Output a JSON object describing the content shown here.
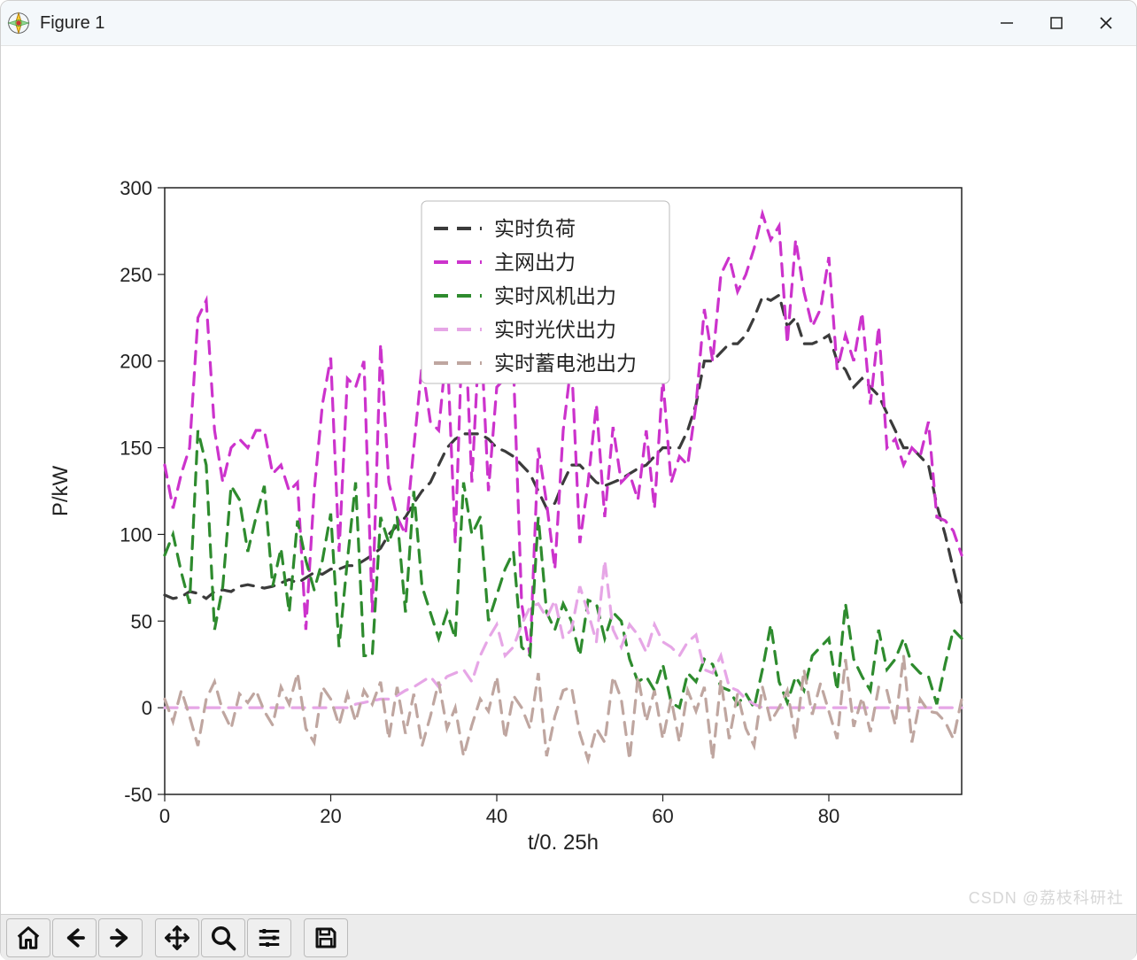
{
  "window": {
    "title": "Figure 1"
  },
  "watermark": "CSDN @荔枝科研社",
  "toolbar": {
    "home": "Home",
    "back": "Back",
    "forward": "Forward",
    "pan": "Pan",
    "zoom": "Zoom",
    "configure": "Configure",
    "save": "Save"
  },
  "chart_data": {
    "type": "line",
    "xlabel": "t/0. 25h",
    "ylabel": "P/kW",
    "xlim": [
      0,
      96
    ],
    "ylim": [
      -50,
      300
    ],
    "x_ticks": [
      0,
      20,
      40,
      60,
      80
    ],
    "y_ticks": [
      -50,
      0,
      50,
      100,
      150,
      200,
      250,
      300
    ],
    "legend_position": "upper-center",
    "line_style": "dashed",
    "x": [
      0,
      1,
      2,
      3,
      4,
      5,
      6,
      7,
      8,
      9,
      10,
      11,
      12,
      13,
      14,
      15,
      16,
      17,
      18,
      19,
      20,
      21,
      22,
      23,
      24,
      25,
      26,
      27,
      28,
      29,
      30,
      31,
      32,
      33,
      34,
      35,
      36,
      37,
      38,
      39,
      40,
      41,
      42,
      43,
      44,
      45,
      46,
      47,
      48,
      49,
      50,
      51,
      52,
      53,
      54,
      55,
      56,
      57,
      58,
      59,
      60,
      61,
      62,
      63,
      64,
      65,
      66,
      67,
      68,
      69,
      70,
      71,
      72,
      73,
      74,
      75,
      76,
      77,
      78,
      79,
      80,
      81,
      82,
      83,
      84,
      85,
      86,
      87,
      88,
      89,
      90,
      91,
      92,
      93,
      94,
      95,
      96
    ],
    "series": [
      {
        "name": "实时负荷",
        "color": "#3b3b3b",
        "values": [
          65,
          63,
          64,
          67,
          66,
          63,
          67,
          68,
          67,
          70,
          71,
          70,
          69,
          70,
          72,
          74,
          72,
          75,
          78,
          77,
          80,
          80,
          82,
          82,
          85,
          88,
          92,
          100,
          105,
          110,
          118,
          125,
          130,
          140,
          150,
          155,
          158,
          158,
          158,
          155,
          150,
          148,
          145,
          140,
          135,
          125,
          115,
          118,
          130,
          140,
          140,
          135,
          130,
          128,
          130,
          132,
          135,
          138,
          140,
          145,
          150,
          150,
          150,
          160,
          175,
          200,
          200,
          205,
          210,
          210,
          215,
          225,
          237,
          235,
          238,
          220,
          225,
          210,
          210,
          212,
          215,
          200,
          195,
          185,
          190,
          185,
          180,
          170,
          160,
          150,
          150,
          145,
          140,
          117,
          100,
          80,
          60
        ]
      },
      {
        "name": "主网出力",
        "color": "#cc33cc",
        "values": [
          140,
          115,
          135,
          150,
          225,
          235,
          160,
          130,
          150,
          155,
          150,
          160,
          160,
          135,
          140,
          125,
          130,
          45,
          125,
          175,
          202,
          90,
          190,
          185,
          200,
          55,
          210,
          130,
          110,
          100,
          150,
          198,
          165,
          160,
          210,
          95,
          240,
          130,
          225,
          125,
          185,
          190,
          198,
          60,
          30,
          150,
          118,
          80,
          160,
          200,
          95,
          130,
          175,
          110,
          162,
          130,
          135,
          120,
          160,
          115,
          190,
          130,
          145,
          140,
          175,
          230,
          200,
          250,
          260,
          240,
          250,
          265,
          285,
          270,
          278,
          210,
          270,
          240,
          220,
          230,
          260,
          195,
          215,
          200,
          228,
          175,
          220,
          150,
          155,
          140,
          150,
          145,
          165,
          110,
          108,
          102,
          88
        ]
      },
      {
        "name": "实时风机出力",
        "color": "#2e8b2e",
        "values": [
          88,
          100,
          78,
          60,
          160,
          140,
          45,
          70,
          128,
          120,
          90,
          110,
          128,
          70,
          92,
          55,
          108,
          85,
          68,
          85,
          112,
          35,
          85,
          130,
          30,
          30,
          110,
          95,
          110,
          55,
          125,
          70,
          55,
          40,
          55,
          40,
          130,
          100,
          110,
          50,
          65,
          80,
          90,
          35,
          30,
          110,
          55,
          45,
          60,
          50,
          30,
          62,
          60,
          40,
          55,
          50,
          28,
          15,
          18,
          10,
          25,
          3,
          0,
          20,
          15,
          28,
          25,
          12,
          10,
          2,
          8,
          0,
          22,
          48,
          15,
          3,
          18,
          10,
          30,
          35,
          40,
          10,
          60,
          28,
          18,
          10,
          45,
          22,
          28,
          40,
          25,
          20,
          18,
          2,
          25,
          45,
          40
        ]
      },
      {
        "name": "实时光伏出力",
        "color": "#e6a6e6",
        "values": [
          0,
          0,
          0,
          0,
          0,
          0,
          0,
          0,
          0,
          0,
          0,
          0,
          0,
          0,
          0,
          0,
          0,
          0,
          0,
          0,
          0,
          0,
          0,
          2,
          3,
          4,
          5,
          5,
          7,
          10,
          12,
          15,
          18,
          12,
          18,
          20,
          22,
          15,
          30,
          40,
          48,
          30,
          35,
          48,
          58,
          60,
          52,
          62,
          40,
          45,
          70,
          55,
          38,
          85,
          45,
          35,
          48,
          42,
          32,
          48,
          38,
          35,
          30,
          38,
          42,
          22,
          20,
          30,
          12,
          10,
          5,
          2,
          0,
          0,
          0,
          0,
          0,
          0,
          0,
          0,
          0,
          0,
          0,
          0,
          0,
          0,
          0,
          0,
          0,
          0,
          0,
          0,
          0,
          0,
          0,
          0,
          0
        ]
      },
      {
        "name": "实时蓄电池出力",
        "color": "#bfa6a0",
        "values": [
          5,
          -8,
          10,
          -5,
          -22,
          5,
          15,
          -2,
          -12,
          8,
          3,
          10,
          -2,
          -10,
          12,
          2,
          20,
          -12,
          -20,
          12,
          5,
          -10,
          8,
          -8,
          10,
          2,
          15,
          -18,
          12,
          -15,
          8,
          -22,
          -5,
          15,
          -12,
          0,
          -28,
          -10,
          5,
          -2,
          18,
          -18,
          7,
          0,
          -12,
          20,
          -28,
          -5,
          10,
          12,
          -15,
          -30,
          -12,
          -20,
          18,
          5,
          -30,
          18,
          -8,
          10,
          -18,
          5,
          -20,
          10,
          -2,
          12,
          -30,
          16,
          -18,
          8,
          -12,
          -22,
          12,
          -8,
          0,
          10,
          -18,
          22,
          -4,
          14,
          -2,
          -18,
          28,
          -11,
          6,
          -14,
          12,
          10,
          -10,
          30,
          -20,
          5,
          -2,
          -3,
          -8,
          -18,
          5
        ]
      }
    ]
  }
}
